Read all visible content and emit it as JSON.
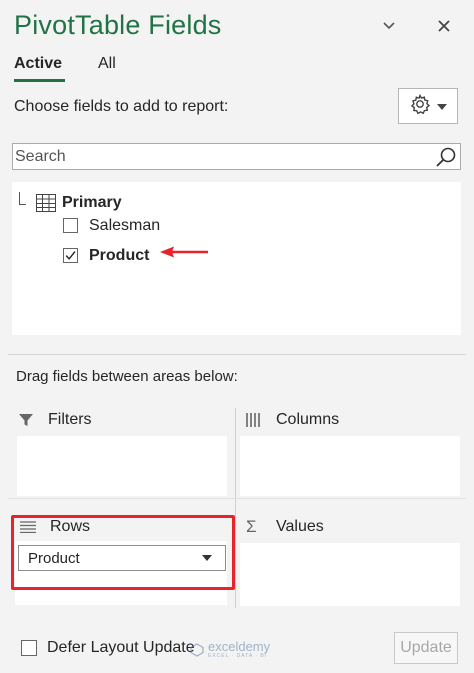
{
  "header": {
    "title": "PivotTable Fields",
    "title_color": "#217346"
  },
  "tabs": [
    {
      "label": "Active",
      "active": true
    },
    {
      "label": "All",
      "active": false
    }
  ],
  "choose_label": "Choose fields to add to report:",
  "search": {
    "placeholder": "Search",
    "value": ""
  },
  "field_list": {
    "table_name": "Primary",
    "fields": [
      {
        "label": "Salesman",
        "checked": false
      },
      {
        "label": "Product",
        "checked": true
      }
    ]
  },
  "drag_label": "Drag fields between areas below:",
  "areas": {
    "filters": {
      "label": "Filters",
      "icon": "filter-icon"
    },
    "columns": {
      "label": "Columns",
      "icon": "columns-icon"
    },
    "rows": {
      "label": "Rows",
      "icon": "rows-icon",
      "items": [
        "Product"
      ]
    },
    "values": {
      "label": "Values",
      "icon": "sigma-icon"
    }
  },
  "footer": {
    "defer_label": "Defer Layout Update",
    "defer_checked": false,
    "update_label": "Update"
  },
  "watermark": {
    "name": "exceldemy",
    "tagline": "EXCEL · DATA · BI"
  },
  "colors": {
    "accent": "#217346",
    "highlight": "#e8232a"
  }
}
